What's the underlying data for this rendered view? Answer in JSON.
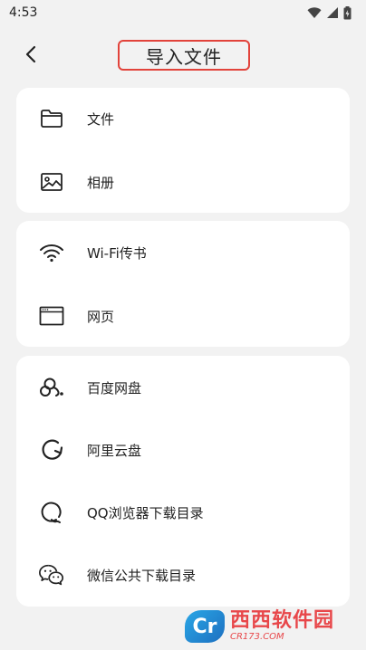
{
  "status_bar": {
    "time": "4:53",
    "icons": [
      "wifi-icon",
      "cell-signal-icon",
      "battery-icon"
    ]
  },
  "header": {
    "back_icon": "chevron-left-icon",
    "title": "导入文件",
    "title_border_color": "#e2433b"
  },
  "groups": [
    {
      "items": [
        {
          "label": "文件",
          "icon": "folder-icon"
        },
        {
          "label": "相册",
          "icon": "image-icon"
        }
      ]
    },
    {
      "items": [
        {
          "label": "Wi-Fi传书",
          "icon": "wifi-icon"
        },
        {
          "label": "网页",
          "icon": "browser-window-icon"
        }
      ]
    },
    {
      "items": [
        {
          "label": "百度网盘",
          "icon": "baidu-netdisk-icon"
        },
        {
          "label": "阿里云盘",
          "icon": "aliyun-drive-icon"
        },
        {
          "label": "QQ浏览器下载目录",
          "icon": "qq-browser-icon"
        },
        {
          "label": "微信公共下载目录",
          "icon": "wechat-icon"
        }
      ]
    }
  ],
  "watermark": {
    "logo": "Cr",
    "name": "西西软件园",
    "url": "CR173.COM"
  }
}
